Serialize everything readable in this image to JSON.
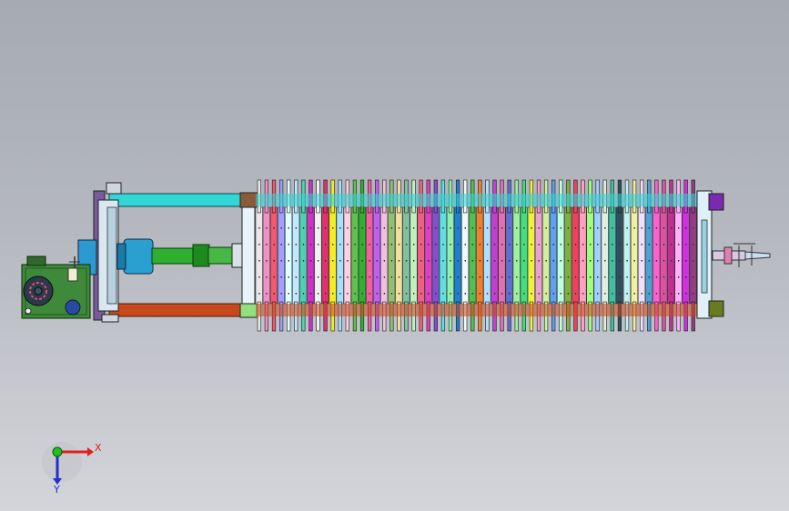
{
  "colors": {
    "background_top": "#a6aab3",
    "background_bottom": "#d3d5da",
    "top_rail": "#33d6d6",
    "bottom_rail": "#c8481c",
    "cylinder_body": "#2aa0d0",
    "piston_rod": "#2fae2f",
    "gearbox_panel": "#3f8a3a",
    "x_axis": "#e02020",
    "y_axis": "#2030d0",
    "z_axis_dot": "#20c020"
  },
  "plate_colors": [
    "#e8e8e8",
    "#f090c8",
    "#f05a6e",
    "#a0a0ff",
    "#e0ffff",
    "#c0e8ff",
    "#50d0b0",
    "#d030c8",
    "#f0f0f0",
    "#e03070",
    "#f0f020",
    "#a8e0ff",
    "#ffd0e0",
    "#60c050",
    "#30b030",
    "#f060a0",
    "#c060f0",
    "#f0c0e0",
    "#90c070",
    "#f0e0a0",
    "#80c0a0",
    "#c0f0c0",
    "#f06080",
    "#e040c0",
    "#8050d0",
    "#60e0e0",
    "#90f0b0",
    "#2080d0",
    "#f0f8f8",
    "#50c050",
    "#f08030",
    "#b0e0ff",
    "#c040d0",
    "#e070b0",
    "#6070d0",
    "#a0f0a0",
    "#40e080",
    "#f0f040",
    "#f0a0d0",
    "#d0f0a0",
    "#60a0f0",
    "#c0ffe0",
    "#80b040",
    "#f04060",
    "#ffa0c0",
    "#a0ff80",
    "#a0d0ff",
    "#e0f0e0",
    "#40c0a0",
    "#305060",
    "#c0f0f0",
    "#f0f0a0",
    "#f0e0ff",
    "#50a0d0",
    "#ff60d0",
    "#e050a0",
    "#c03090",
    "#ffb0ff",
    "#d030e0",
    "#904080"
  ],
  "axis_labels": {
    "x": "X",
    "y": "Y"
  }
}
